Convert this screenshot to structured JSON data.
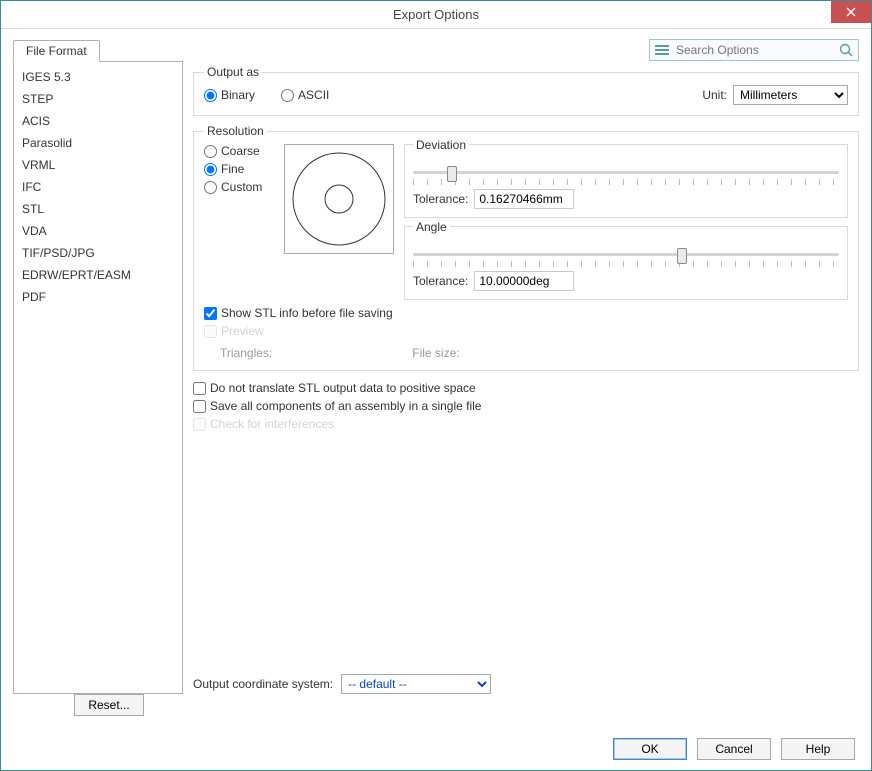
{
  "window": {
    "title": "Export Options"
  },
  "search": {
    "placeholder": "Search Options"
  },
  "tab": {
    "label": "File Format"
  },
  "sidebar": {
    "items": [
      {
        "label": "IGES 5.3"
      },
      {
        "label": "STEP"
      },
      {
        "label": "ACIS"
      },
      {
        "label": "Parasolid"
      },
      {
        "label": "VRML"
      },
      {
        "label": "IFC"
      },
      {
        "label": "STL"
      },
      {
        "label": "VDA"
      },
      {
        "label": "TIF/PSD/JPG"
      },
      {
        "label": "EDRW/EPRT/EASM"
      },
      {
        "label": "PDF"
      }
    ],
    "selected_index": 6
  },
  "output_as": {
    "legend": "Output as",
    "binary": "Binary",
    "ascii": "ASCII",
    "selected": "binary",
    "unit_label": "Unit:",
    "unit_value": "Millimeters"
  },
  "resolution": {
    "legend": "Resolution",
    "coarse": "Coarse",
    "fine": "Fine",
    "custom": "Custom",
    "selected": "fine",
    "show_info": "Show STL info before file saving",
    "show_info_checked": true,
    "preview": "Preview",
    "triangles_label": "Triangles:",
    "filesize_label": "File size:"
  },
  "deviation": {
    "legend": "Deviation",
    "tolerance_label": "Tolerance:",
    "tolerance_value": "0.16270466mm",
    "slider_pos_pct": 8
  },
  "angle": {
    "legend": "Angle",
    "tolerance_label": "Tolerance:",
    "tolerance_value": "10.00000deg",
    "slider_pos_pct": 62
  },
  "options": {
    "no_translate": "Do not translate STL output data to positive space",
    "save_all": "Save all components of an assembly in a single file",
    "check_interf": "Check for interferences"
  },
  "coord": {
    "label": "Output coordinate system:",
    "value": "-- default --"
  },
  "buttons": {
    "reset": "Reset...",
    "ok": "OK",
    "cancel": "Cancel",
    "help": "Help"
  }
}
